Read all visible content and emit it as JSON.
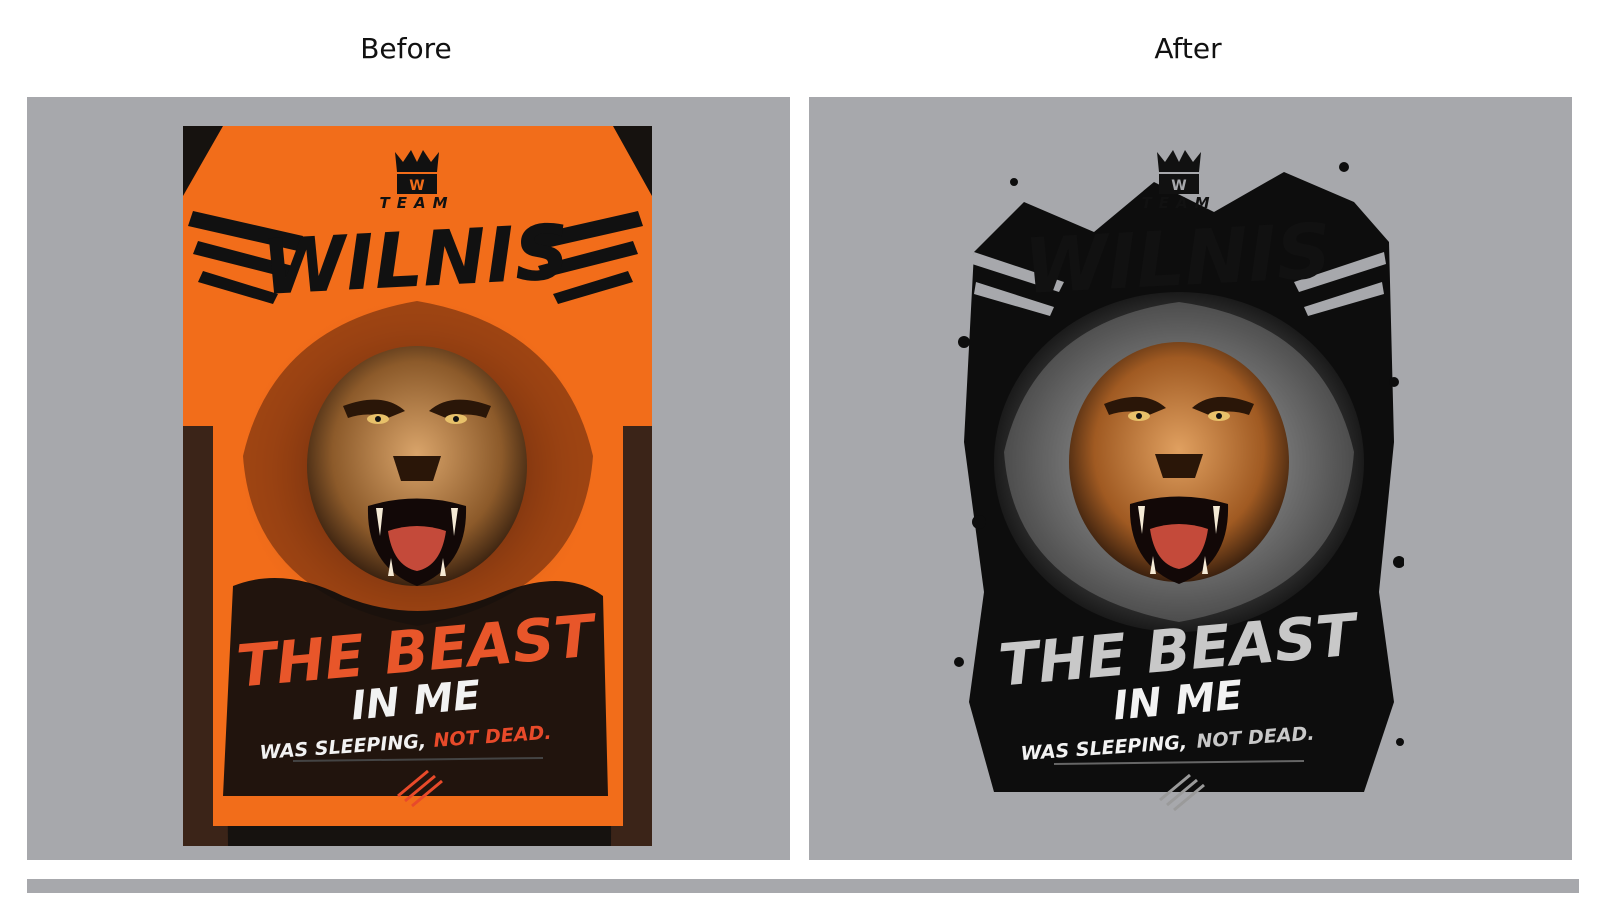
{
  "labels": {
    "before": "Before",
    "after": "After"
  },
  "design": {
    "brand_top": "TEAM",
    "brand_name": "WILNIS",
    "headline": "THE BEAST",
    "subline": "IN ME",
    "tagline_part1": "WAS SLEEPING,",
    "tagline_part2": "NOT DEAD."
  },
  "colors": {
    "panel": "#a7a8ac",
    "shirt_orange": "#f26d1a",
    "ink_black": "#111111",
    "highlight_red": "#e84a2a",
    "text_white": "#f2f2f2",
    "text_gray": "#c8c8c8"
  }
}
